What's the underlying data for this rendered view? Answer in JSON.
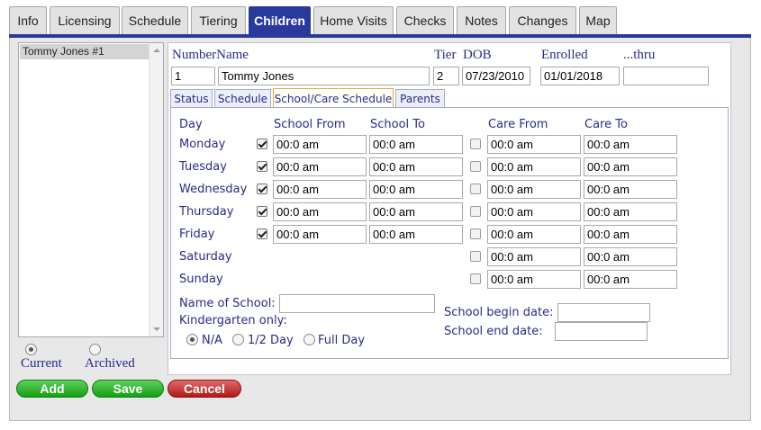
{
  "tabs": [
    {
      "label": "Info",
      "active": false
    },
    {
      "label": "Licensing",
      "active": false
    },
    {
      "label": "Schedule",
      "active": false
    },
    {
      "label": "Tiering",
      "active": false
    },
    {
      "label": "Children",
      "active": true
    },
    {
      "label": "Home Visits",
      "active": false
    },
    {
      "label": "Checks",
      "active": false
    },
    {
      "label": "Notes",
      "active": false
    },
    {
      "label": "Changes",
      "active": false
    },
    {
      "label": "Map",
      "active": false
    }
  ],
  "child_list": {
    "items": [
      "Tommy Jones #1"
    ],
    "filter": {
      "current_label": "Current",
      "archived_label": "Archived",
      "selected": "Current"
    }
  },
  "buttons": {
    "add": "Add",
    "save": "Save",
    "cancel": "Cancel"
  },
  "header": {
    "number_label": "NumberName",
    "tier_label": "Tier",
    "dob_label": "DOB",
    "enrolled_label": "Enrolled",
    "thru_label": "...thru",
    "number_value": "1",
    "name_value": "Tommy Jones",
    "tier_value": "2",
    "dob_value": "07/23/2010",
    "enrolled_value": "01/01/2018",
    "thru_value": ""
  },
  "subtabs": [
    {
      "label": "Status",
      "active": false
    },
    {
      "label": "Schedule",
      "active": false
    },
    {
      "label": "School/Care Schedule",
      "active": true
    },
    {
      "label": "Parents",
      "active": false
    }
  ],
  "schedule": {
    "columns": {
      "day": "Day",
      "school_from": "School From",
      "school_to": "School To",
      "care_from": "Care From",
      "care_to": "Care To"
    },
    "rows": [
      {
        "day": "Monday",
        "school_checked": true,
        "school_from": "00:0 am",
        "school_to": "00:0 am",
        "care_checked": false,
        "care_from": "00:0 am",
        "care_to": "00:0 am"
      },
      {
        "day": "Tuesday",
        "school_checked": true,
        "school_from": "00:0 am",
        "school_to": "00:0 am",
        "care_checked": false,
        "care_from": "00:0 am",
        "care_to": "00:0 am"
      },
      {
        "day": "Wednesday",
        "school_checked": true,
        "school_from": "00:0 am",
        "school_to": "00:0 am",
        "care_checked": false,
        "care_from": "00:0 am",
        "care_to": "00:0 am"
      },
      {
        "day": "Thursday",
        "school_checked": true,
        "school_from": "00:0 am",
        "school_to": "00:0 am",
        "care_checked": false,
        "care_from": "00:0 am",
        "care_to": "00:0 am"
      },
      {
        "day": "Friday",
        "school_checked": true,
        "school_from": "00:0 am",
        "school_to": "00:0 am",
        "care_checked": false,
        "care_from": "00:0 am",
        "care_to": "00:0 am"
      },
      {
        "day": "Saturday",
        "school_checked": null,
        "school_from": null,
        "school_to": null,
        "care_checked": false,
        "care_from": "00:0 am",
        "care_to": "00:0 am"
      },
      {
        "day": "Sunday",
        "school_checked": null,
        "school_from": null,
        "school_to": null,
        "care_checked": false,
        "care_from": "00:0 am",
        "care_to": "00:0 am"
      }
    ]
  },
  "school": {
    "name_label": "Name of School:",
    "name_value": "",
    "kindergarten_label": "Kindergarten only:",
    "kindergarten_options": [
      "N/A",
      "1/2 Day",
      "Full Day"
    ],
    "kindergarten_selected": "N/A",
    "begin_label": "School begin date:",
    "begin_value": "",
    "end_label": "School end date:",
    "end_value": ""
  }
}
